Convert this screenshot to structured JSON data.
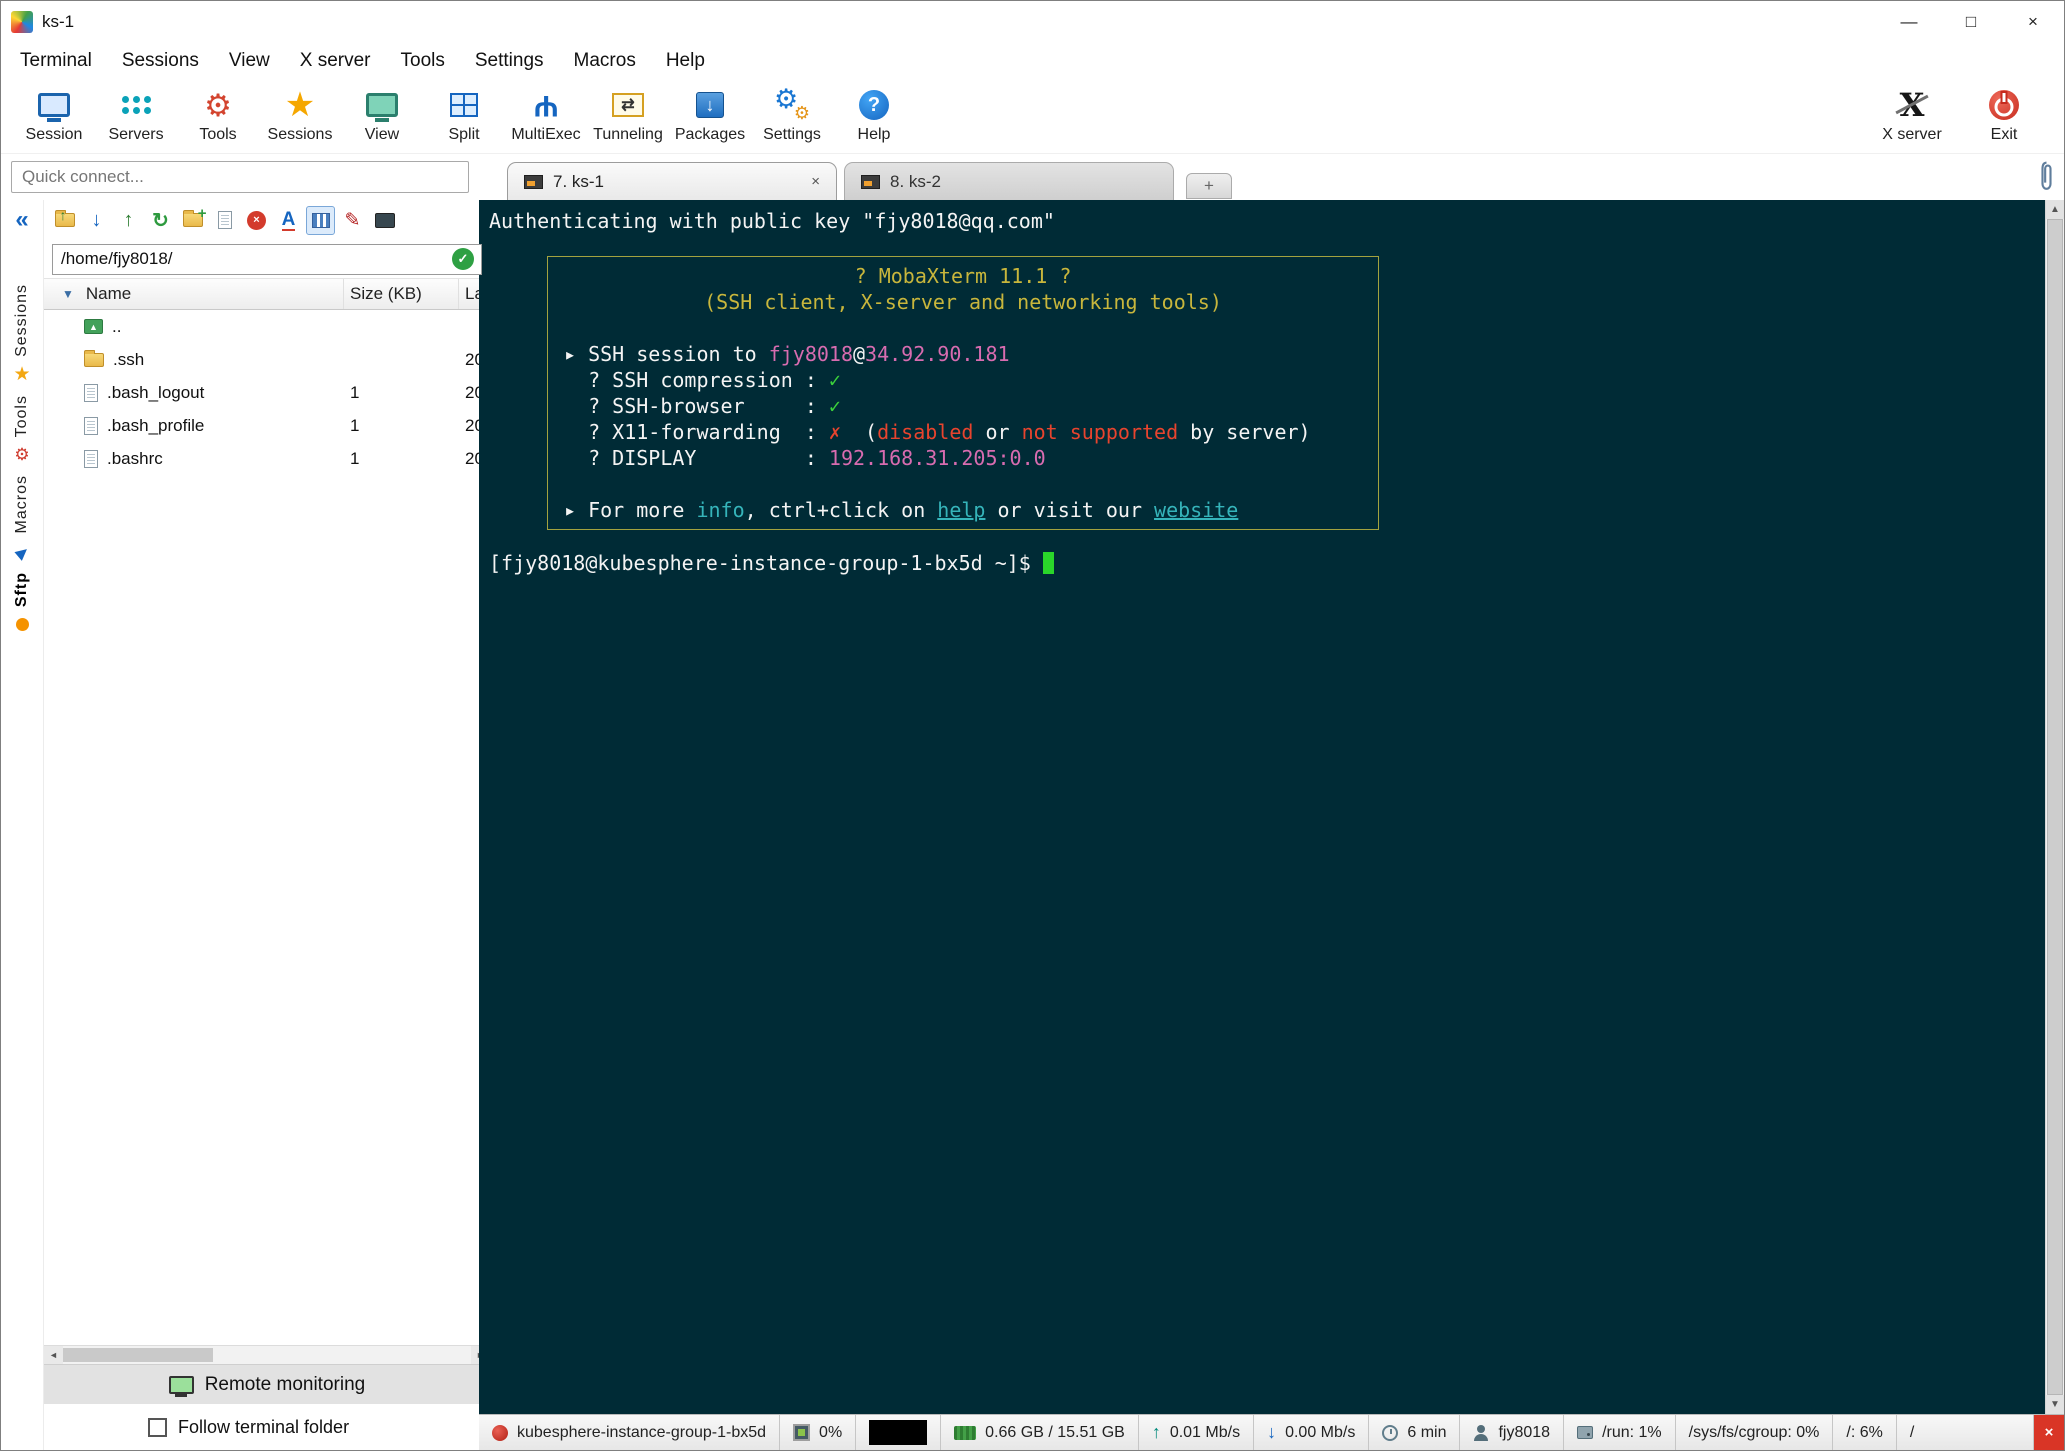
{
  "window": {
    "title": "ks-1",
    "minimize": "—",
    "maximize": "□",
    "close": "×"
  },
  "menu": {
    "items": [
      "Terminal",
      "Sessions",
      "View",
      "X server",
      "Tools",
      "Settings",
      "Macros",
      "Help"
    ]
  },
  "toolbar": {
    "buttons": [
      {
        "id": "session",
        "label": "Session"
      },
      {
        "id": "servers",
        "label": "Servers"
      },
      {
        "id": "tools",
        "label": "Tools"
      },
      {
        "id": "sessions",
        "label": "Sessions"
      },
      {
        "id": "view",
        "label": "View"
      },
      {
        "id": "split",
        "label": "Split"
      },
      {
        "id": "multiexec",
        "label": "MultiExec"
      },
      {
        "id": "tunneling",
        "label": "Tunneling"
      },
      {
        "id": "packages",
        "label": "Packages"
      },
      {
        "id": "settings",
        "label": "Settings"
      },
      {
        "id": "help",
        "label": "Help"
      }
    ],
    "right_buttons": [
      {
        "id": "xserver",
        "label": "X server"
      },
      {
        "id": "exit",
        "label": "Exit"
      }
    ]
  },
  "quick_connect": {
    "placeholder": "Quick connect..."
  },
  "tabs": {
    "items": [
      {
        "label": "7. ks-1",
        "active": true,
        "close_glyph": "×"
      },
      {
        "label": "8. ks-2",
        "active": false
      }
    ],
    "new_tab_glyph": "+"
  },
  "sidebar": {
    "collapse_glyph": "«",
    "items": [
      {
        "label": "Sessions",
        "icon": "star-icon",
        "active": false
      },
      {
        "label": "Tools",
        "icon": "tools-icon",
        "active": false
      },
      {
        "label": "Macros",
        "icon": "send-icon",
        "active": false
      },
      {
        "label": "Sftp",
        "icon": "dot-icon",
        "active": true
      }
    ]
  },
  "sftp": {
    "toolbar_icons": [
      "up-directory-icon",
      "download-icon",
      "upload-icon",
      "refresh-icon",
      "new-folder-icon",
      "document-icon",
      "delete-icon",
      "rename-icon",
      "columns-icon",
      "edit-icon",
      "terminal-icon"
    ],
    "active_toolbar_icon": "columns-icon",
    "path": "/home/fjy8018/",
    "path_valid_glyph": "✓",
    "columns": {
      "name": "Name",
      "size": "Size (KB)",
      "modified": "La"
    },
    "rows": [
      {
        "name": "..",
        "size": "",
        "modified": "",
        "icon": "up-dir"
      },
      {
        "name": ".ssh",
        "size": "",
        "modified": "20",
        "icon": "folder"
      },
      {
        "name": ".bash_logout",
        "size": "1",
        "modified": "20",
        "icon": "file"
      },
      {
        "name": ".bash_profile",
        "size": "1",
        "modified": "20",
        "icon": "file"
      },
      {
        "name": ".bashrc",
        "size": "1",
        "modified": "20",
        "icon": "file"
      }
    ],
    "remote_monitoring_label": "Remote monitoring",
    "follow_label": "Follow terminal folder",
    "follow_checked": false
  },
  "terminal": {
    "auth_line": "Authenticating with public key \"fjy8018@qq.com\"",
    "banner": {
      "lines": [
        {
          "align": "center",
          "segs": [
            {
              "t": "? MobaXterm 11.1 ?",
              "c": "y"
            }
          ]
        },
        {
          "align": "center",
          "segs": [
            {
              "t": "(SSH client, X-server and networking tools)",
              "c": "y"
            }
          ]
        },
        {
          "segs": []
        },
        {
          "segs": [
            {
              "t": "▸ SSH session to ",
              "c": "w"
            },
            {
              "t": "fjy8018",
              "c": "m"
            },
            {
              "t": "@",
              "c": "w"
            },
            {
              "t": "34.92.90.181",
              "c": "m"
            }
          ]
        },
        {
          "segs": [
            {
              "t": "  ? SSH compression : ",
              "c": "w"
            },
            {
              "t": "✓",
              "c": "g"
            }
          ]
        },
        {
          "segs": [
            {
              "t": "  ? SSH-browser     : ",
              "c": "w"
            },
            {
              "t": "✓",
              "c": "g"
            }
          ]
        },
        {
          "segs": [
            {
              "t": "  ? X11-forwarding  : ",
              "c": "w"
            },
            {
              "t": "✗",
              "c": "r"
            },
            {
              "t": "  (",
              "c": "w"
            },
            {
              "t": "disabled",
              "c": "r"
            },
            {
              "t": " or ",
              "c": "w"
            },
            {
              "t": "not supported",
              "c": "r"
            },
            {
              "t": " by server)",
              "c": "w"
            }
          ]
        },
        {
          "segs": [
            {
              "t": "  ? DISPLAY         : ",
              "c": "w"
            },
            {
              "t": "192.168.31.205:0.0",
              "c": "m"
            }
          ]
        },
        {
          "segs": []
        },
        {
          "segs": [
            {
              "t": "▸ For more ",
              "c": "w"
            },
            {
              "t": "info",
              "c": "c"
            },
            {
              "t": ", ctrl+click on ",
              "c": "w"
            },
            {
              "t": "help",
              "c": "cu"
            },
            {
              "t": " or visit our ",
              "c": "w"
            },
            {
              "t": "website",
              "c": "cu"
            }
          ]
        }
      ]
    },
    "prompt": "[fjy8018@kubesphere-instance-group-1-bx5d ~]$",
    "colors": {
      "background": "#002b36",
      "white": "#f4f4f4",
      "yellow": "#c8b63c",
      "magenta": "#d86cb0",
      "green": "#3bd23b",
      "red": "#e8442e",
      "cyan": "#35b4ba",
      "cursor": "#2ad62a"
    }
  },
  "statusbar": {
    "cells": [
      {
        "icon": "host-icon",
        "text": "kubesphere-instance-group-1-bx5d"
      },
      {
        "icon": "cpu-icon",
        "text": "0%"
      },
      {
        "icon": "graph-icon",
        "text": ""
      },
      {
        "icon": "memory-icon",
        "text": "0.66 GB / 15.51 GB"
      },
      {
        "icon": "upload-icon",
        "text": "0.01 Mb/s"
      },
      {
        "icon": "download-icon",
        "text": "0.00 Mb/s"
      },
      {
        "icon": "clock-icon",
        "text": "6 min"
      },
      {
        "icon": "user-icon",
        "text": "fjy8018"
      },
      {
        "icon": "disk-icon",
        "text": "/run: 1%"
      },
      {
        "icon": null,
        "text": "/sys/fs/cgroup: 0%"
      },
      {
        "icon": null,
        "text": "/: 6%"
      },
      {
        "icon": null,
        "text": "/"
      }
    ],
    "close_glyph": "×"
  }
}
